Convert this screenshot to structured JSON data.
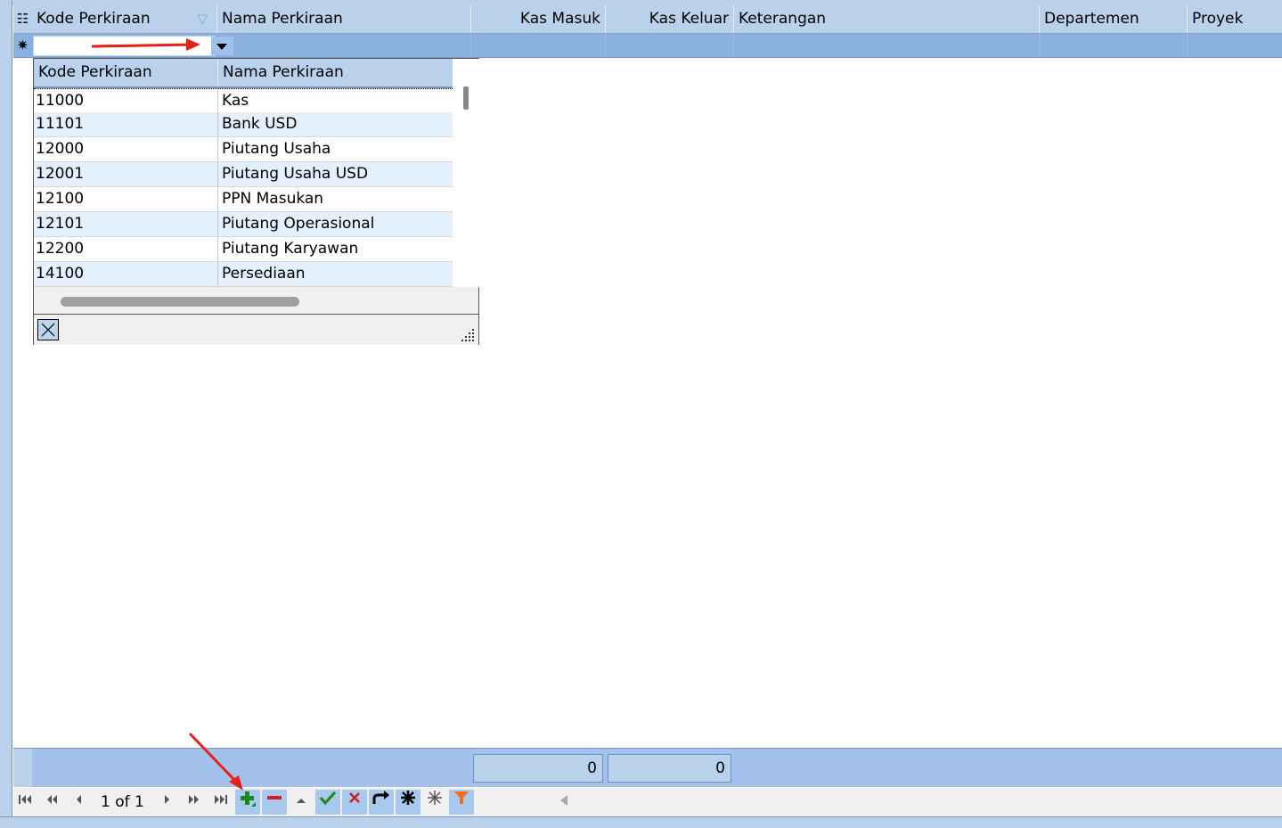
{
  "grid": {
    "columns": [
      {
        "key": "kode",
        "label": "Kode Perkiraan"
      },
      {
        "key": "nama",
        "label": "Nama Perkiraan"
      },
      {
        "key": "masuk",
        "label": "Kas Masuk"
      },
      {
        "key": "keluar",
        "label": "Kas Keluar"
      },
      {
        "key": "ket",
        "label": "Keterangan"
      },
      {
        "key": "dept",
        "label": "Departemen"
      },
      {
        "key": "proyek",
        "label": "Proyek"
      }
    ],
    "new_row_symbol": "✷",
    "column_chooser_symbol": "☷",
    "filter_symbol": "▽"
  },
  "dropdown": {
    "columns": [
      "Kode Perkiraan",
      "Nama Perkiraan"
    ],
    "rows": [
      {
        "kode": "11000",
        "nama": "Kas"
      },
      {
        "kode": "11101",
        "nama": "Bank USD"
      },
      {
        "kode": "12000",
        "nama": "Piutang Usaha"
      },
      {
        "kode": "12001",
        "nama": "Piutang Usaha USD"
      },
      {
        "kode": "12100",
        "nama": "PPN Masukan"
      },
      {
        "kode": "12101",
        "nama": "Piutang Operasional"
      },
      {
        "kode": "12200",
        "nama": "Piutang Karyawan"
      },
      {
        "kode": "14100",
        "nama": "Persediaan"
      }
    ]
  },
  "totals": {
    "kas_masuk": "0",
    "kas_keluar": "0"
  },
  "navigator": {
    "record_text": "1 of 1",
    "buttons": [
      "first",
      "prev-page",
      "prev",
      "next",
      "next-page",
      "last",
      "append",
      "delete",
      "edit",
      "post",
      "cancel",
      "refresh",
      "save-bookmark",
      "goto-bookmark",
      "filter"
    ]
  },
  "colors": {
    "header_bg": "#b9d1ea",
    "row_selected_bg": "#8ab0de",
    "alt_row_bg": "#e4f0fb",
    "annotation_arrow": "#e8201c",
    "add_icon": "#1a8a1a",
    "delete_icon": "#d02020",
    "filter_icon": "#f07020"
  }
}
